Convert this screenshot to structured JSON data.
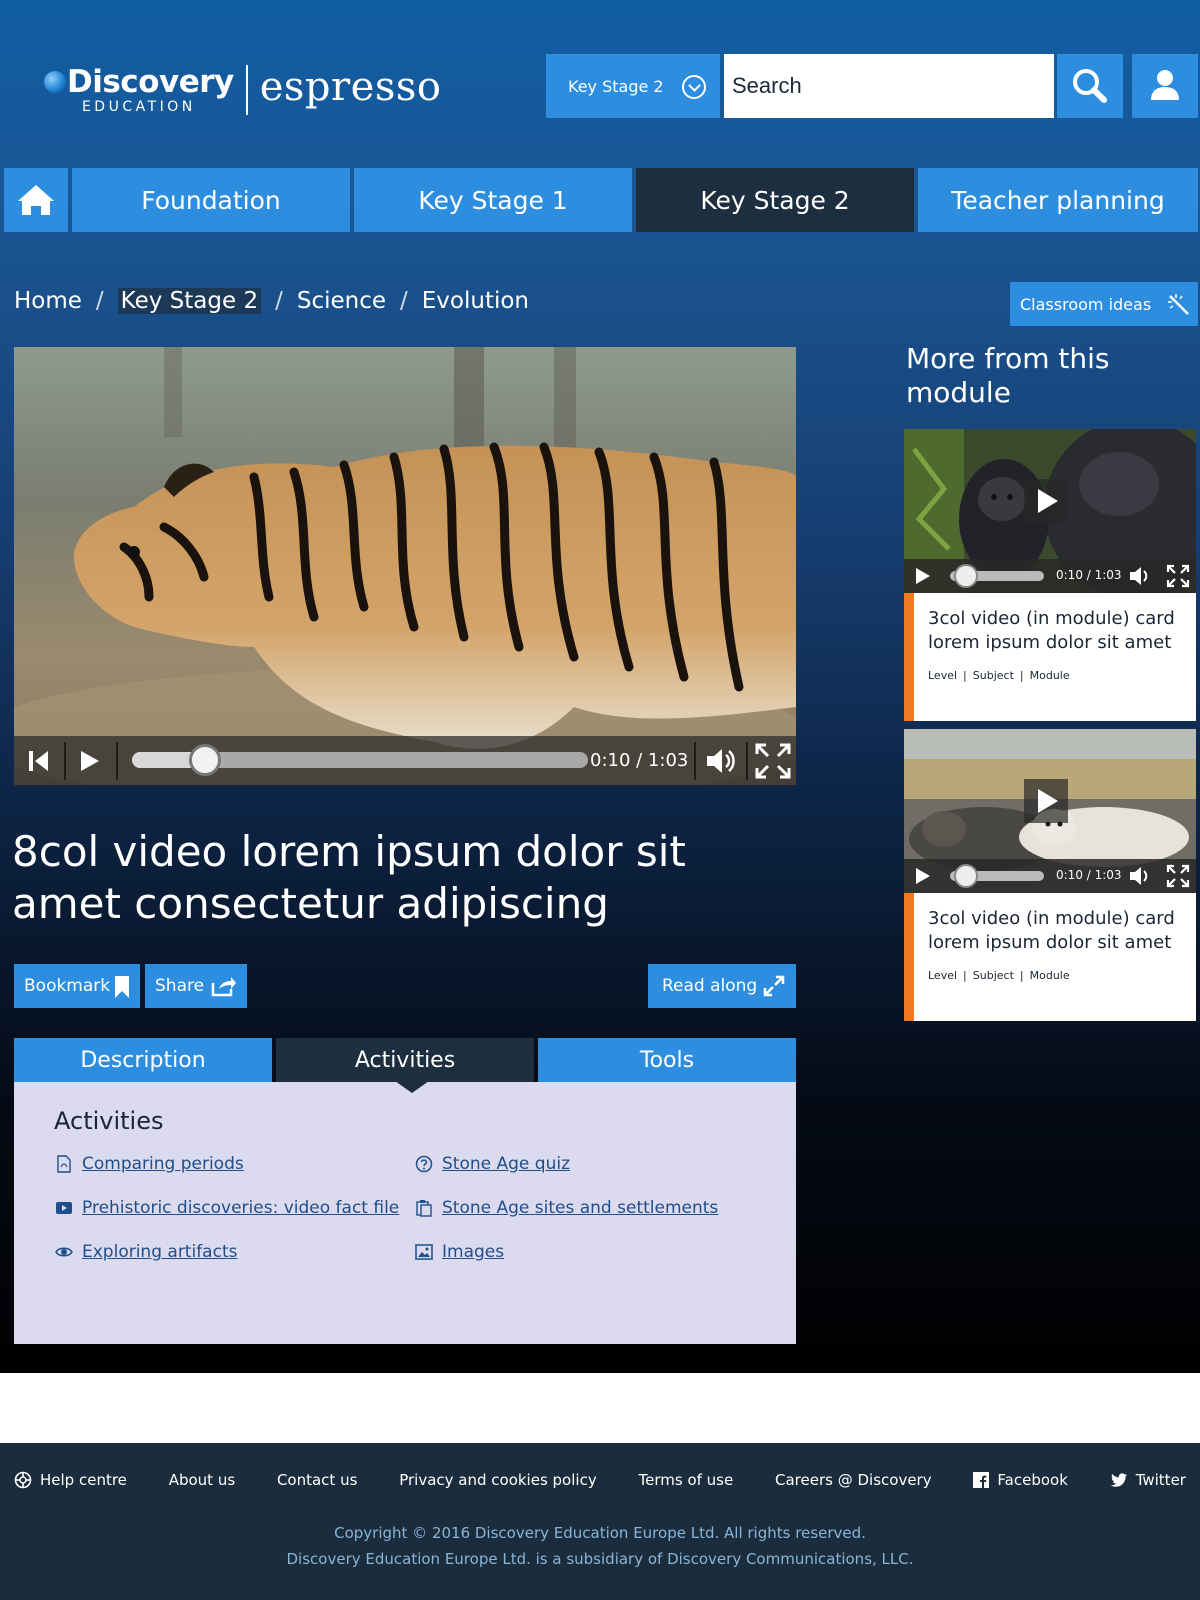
{
  "header": {
    "logo_top": "Discovery",
    "logo_bottom": "EDUCATION",
    "logo_product": "espresso",
    "stage_select": "Key Stage 2",
    "search_placeholder": "Search"
  },
  "nav": {
    "tabs": [
      {
        "label": "Foundation"
      },
      {
        "label": "Key Stage 1"
      },
      {
        "label": "Key Stage 2"
      },
      {
        "label": "Teacher planning"
      }
    ],
    "active": "Key Stage 2"
  },
  "breadcrumb": [
    "Home",
    "Key Stage 2",
    "Science",
    "Evolution"
  ],
  "classroom_ideas": "Classroom ideas",
  "player": {
    "time": "0:10 / 1:03",
    "progress": 0.16
  },
  "video_title": "8col video lorem ipsum dolor sit amet consectetur adipiscing",
  "actions": {
    "bookmark": "Bookmark",
    "share": "Share",
    "read_along": "Read along"
  },
  "tabs": [
    {
      "label": "Description"
    },
    {
      "label": "Activities"
    },
    {
      "label": "Tools"
    }
  ],
  "activities": {
    "title": "Activities",
    "items": [
      {
        "label": "Comparing periods",
        "icon": "pdf-icon"
      },
      {
        "label": "Prehistoric discoveries: video fact file",
        "icon": "video-icon"
      },
      {
        "label": "Exploring artifacts",
        "icon": "eye-icon"
      },
      {
        "label": "Stone Age quiz",
        "icon": "question-icon"
      },
      {
        "label": "Stone Age sites and settlements",
        "icon": "clipboard-icon"
      },
      {
        "label": "Images",
        "icon": "image-icon"
      }
    ]
  },
  "sidebar": {
    "title": "More from this module",
    "cards": [
      {
        "title": "3col video (in module) card lorem ipsum dolor sit amet",
        "time": "0:10 / 1:03",
        "meta": [
          "Level",
          "Subject",
          "Module"
        ]
      },
      {
        "title": "3col video (in module) card lorem ipsum dolor sit amet",
        "time": "0:10 / 1:03",
        "meta": [
          "Level",
          "Subject",
          "Module"
        ]
      }
    ]
  },
  "footer": {
    "links": [
      "Help centre",
      "About us",
      "Contact us",
      "Privacy and cookies policy",
      "Terms of use",
      "Careers @ Discovery",
      "Facebook",
      "Twitter"
    ],
    "copyright_1": "Copyright © 2016 Discovery Education Europe Ltd. All rights reserved.",
    "copyright_2": "Discovery Education Europe Ltd. is a subsidiary of Discovery Communications, LLC."
  },
  "colors": {
    "accent": "#2d8ee0",
    "active_tab": "#1d2f3f",
    "card_accent": "#ef7a22",
    "panel_bg": "#dcdaef"
  }
}
